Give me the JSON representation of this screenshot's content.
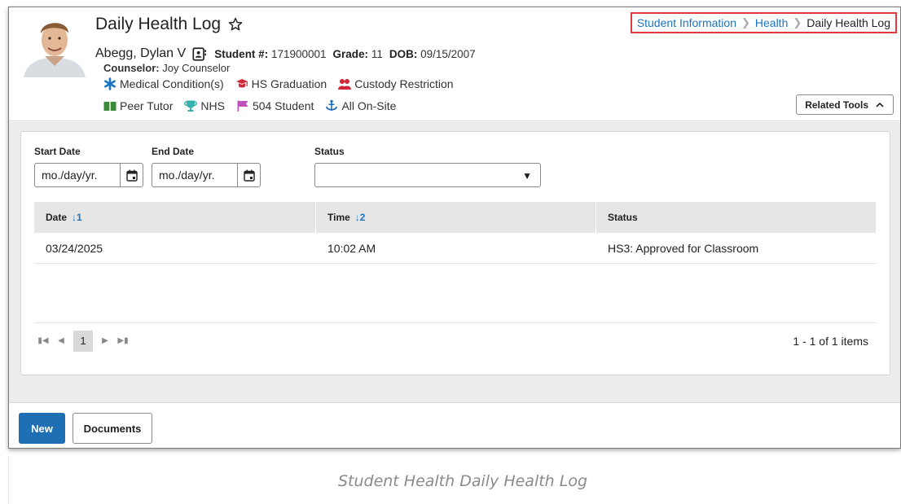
{
  "header": {
    "page_title": "Daily Health Log",
    "breadcrumb": [
      "Student Information",
      "Health",
      "Daily Health Log"
    ],
    "student_name": "Abegg, Dylan V",
    "student_number_label": "Student #:",
    "student_number": "171900001",
    "grade_label": "Grade:",
    "grade": "11",
    "dob_label": "DOB:",
    "dob": "09/15/2007",
    "counselor_label": "Counselor:",
    "counselor": "Joy Counselor",
    "flags_row1": [
      {
        "label": "Medical Condition(s)",
        "icon": "asterisk-icon",
        "color": "#1a73c0"
      },
      {
        "label": "HS Graduation",
        "icon": "graduation-cap-icon",
        "color": "#d0283a"
      },
      {
        "label": "Custody Restriction",
        "icon": "people-icon",
        "color": "#d0283a"
      }
    ],
    "flags_row2": [
      {
        "label": "Peer Tutor",
        "icon": "book-icon",
        "color": "#3a8a3a"
      },
      {
        "label": "NHS",
        "icon": "trophy-icon",
        "color": "#3ab0b0"
      },
      {
        "label": "504 Student",
        "icon": "flag-icon",
        "color": "#c050b8"
      },
      {
        "label": "All On-Site",
        "icon": "anchor-icon",
        "color": "#1f6fb5"
      }
    ],
    "related_tools_label": "Related Tools"
  },
  "filters": {
    "start_date_label": "Start Date",
    "start_date_placeholder": "mo./day/yr.",
    "end_date_label": "End Date",
    "end_date_placeholder": "mo./day/yr.",
    "status_label": "Status",
    "status_value": ""
  },
  "grid": {
    "columns": [
      {
        "label": "Date",
        "sort": "↓1"
      },
      {
        "label": "Time",
        "sort": "↓2"
      },
      {
        "label": "Status",
        "sort": ""
      }
    ],
    "rows": [
      [
        "03/24/2025",
        "10:02 AM",
        "HS3: Approved for Classroom"
      ]
    ],
    "pager": {
      "current_page": "1",
      "info": "1 - 1 of 1 items"
    }
  },
  "footer": {
    "new_label": "New",
    "documents_label": "Documents"
  },
  "caption": "Student Health Daily Health Log",
  "colors": {
    "accent": "#1f6fb5",
    "link": "#1a73c0",
    "highlight": "#e0393e"
  }
}
